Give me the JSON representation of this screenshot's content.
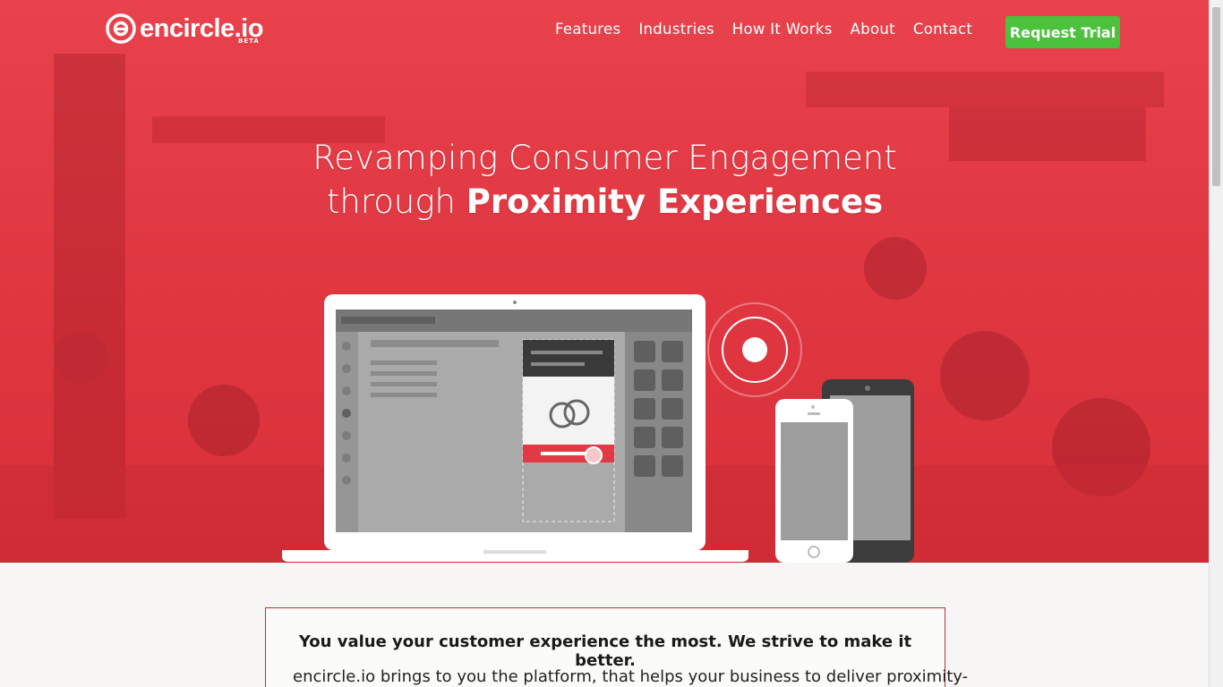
{
  "brand": {
    "name": "encircle.io",
    "badge": "BETA"
  },
  "nav": {
    "items": [
      "Features",
      "Industries",
      "How It Works",
      "About",
      "Contact"
    ],
    "cta": "Request Trial"
  },
  "hero": {
    "line1": "Revamping Consumer Engagement",
    "line2_prefix": "through ",
    "line2_bold": "Proximity Experiences"
  },
  "intro": {
    "heading": "You value your customer experience the most. We strive to make it better.",
    "body": "encircle.io brings to you the platform, that helps your business to deliver proximity-"
  },
  "colors": {
    "hero_red": "#e23a44",
    "cta_green": "#4cc13b",
    "border_red": "#c42a33"
  }
}
